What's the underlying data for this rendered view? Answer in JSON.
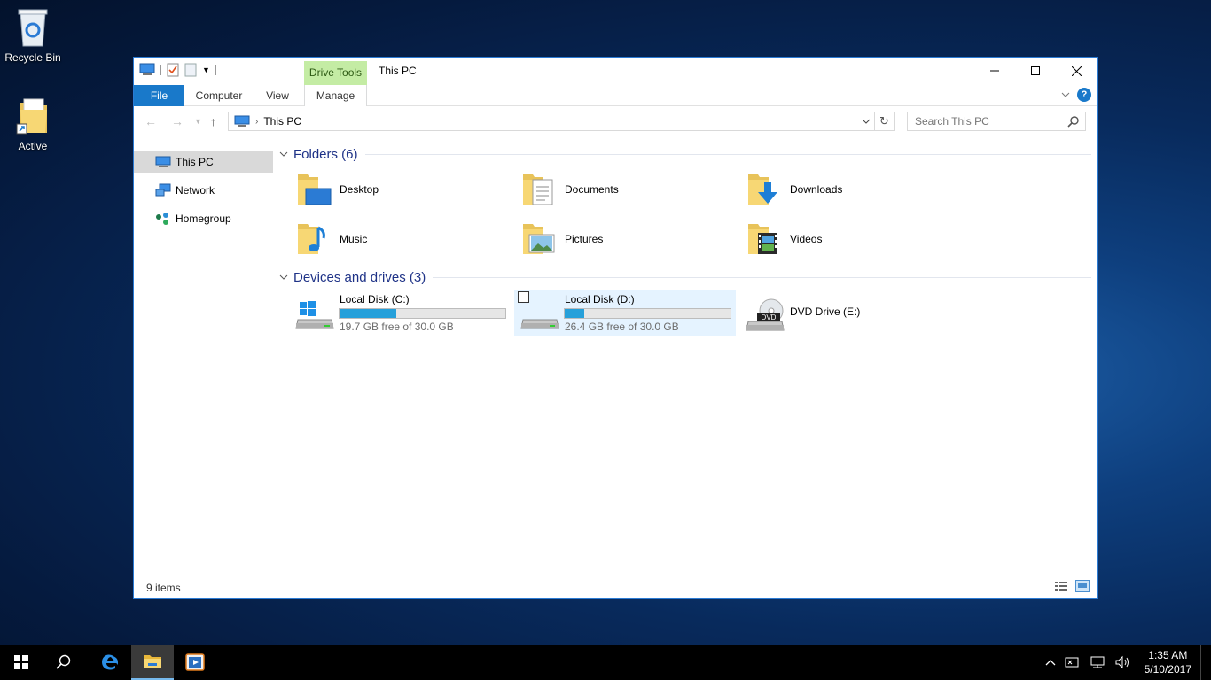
{
  "desktop": {
    "icons": [
      {
        "label": "Recycle Bin",
        "icon": "recycle-bin-icon"
      },
      {
        "label": "Active",
        "icon": "shortcut-folder-icon"
      }
    ]
  },
  "window": {
    "title": "This PC",
    "context_tab": "Drive Tools",
    "ribbon_tabs": [
      "File",
      "Computer",
      "View",
      "Manage"
    ],
    "controls": {
      "minimize": "—",
      "maximize": "☐",
      "close": "✕"
    },
    "address": {
      "path": "This PC"
    },
    "search": {
      "placeholder": "Search This PC"
    }
  },
  "navpane": {
    "items": [
      {
        "label": "This PC",
        "icon": "computer-icon",
        "selected": true
      },
      {
        "label": "Network",
        "icon": "network-icon",
        "selected": false
      },
      {
        "label": "Homegroup",
        "icon": "homegroup-icon",
        "selected": false
      }
    ]
  },
  "folders": {
    "header": "Folders (6)",
    "items": [
      {
        "label": "Desktop",
        "icon": "desktop-folder-icon"
      },
      {
        "label": "Documents",
        "icon": "documents-folder-icon"
      },
      {
        "label": "Downloads",
        "icon": "downloads-folder-icon"
      },
      {
        "label": "Music",
        "icon": "music-folder-icon"
      },
      {
        "label": "Pictures",
        "icon": "pictures-folder-icon"
      },
      {
        "label": "Videos",
        "icon": "videos-folder-icon"
      }
    ]
  },
  "drives": {
    "header": "Devices and drives (3)",
    "items": [
      {
        "name": "Local Disk (C:)",
        "free": "19.7 GB free of 30.0 GB",
        "used_fraction": 0.343,
        "icon": "windows-drive-icon"
      },
      {
        "name": "Local Disk (D:)",
        "free": "26.4 GB free of 30.0 GB",
        "used_fraction": 0.12,
        "icon": "drive-icon"
      },
      {
        "name": "DVD Drive (E:)",
        "icon": "dvd-drive-icon",
        "badge": "DVD"
      }
    ]
  },
  "status": {
    "items": "9 items"
  },
  "taskbar": {
    "clock": {
      "time": "1:35 AM",
      "date": "5/10/2017"
    }
  },
  "colors": {
    "accent": "#1979ca",
    "ribbon_context": "#c4eca4",
    "bar_fill": "#26a0da"
  }
}
